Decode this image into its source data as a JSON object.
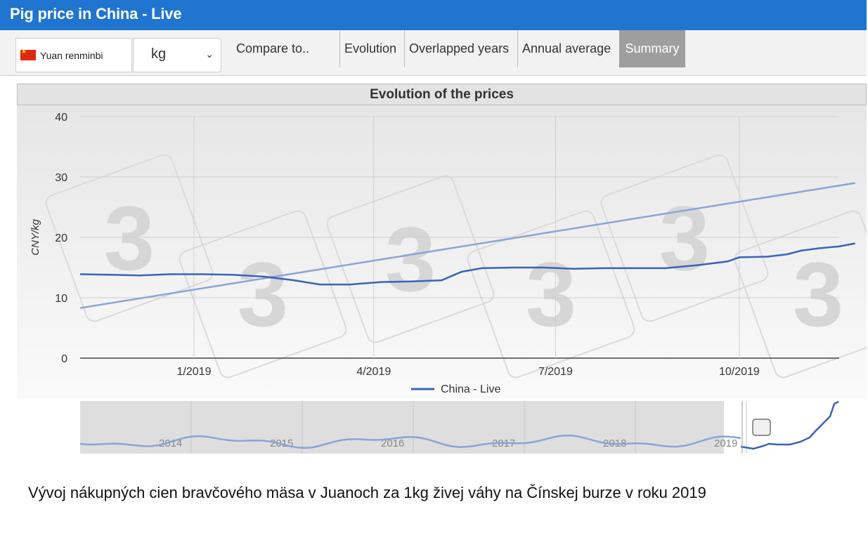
{
  "header": {
    "title": "Pig price in China - Live"
  },
  "toolbar": {
    "currency_label": "Yuan renminbi",
    "unit_value": "kg",
    "compare_label": "Compare to..",
    "tabs": [
      {
        "label": "Evolution"
      },
      {
        "label": "Overlapped years"
      },
      {
        "label": "Annual average"
      },
      {
        "label": "Summary",
        "active": true
      }
    ]
  },
  "colors": {
    "accent": "#1f75d0",
    "series": "#3a63b8",
    "trend": "#8aa4d8",
    "active_tab": "#9e9e9e"
  },
  "chart_data": {
    "type": "line",
    "title": "Evolution of the prices",
    "xlabel": "",
    "ylabel": "CNY/kg",
    "x_ticks": [
      "1/2019",
      "4/2019",
      "7/2019",
      "10/2019"
    ],
    "y_ticks": [
      0,
      10,
      20,
      30,
      40
    ],
    "ylim": [
      0,
      40
    ],
    "xlim": [
      "2018-11-05",
      "2019-11-20"
    ],
    "grid": true,
    "legend": "bottom",
    "series": [
      {
        "name": "China - Live",
        "points": [
          [
            "2018-11-05",
            13.9
          ],
          [
            "2018-11-20",
            13.8
          ],
          [
            "2018-12-05",
            13.7
          ],
          [
            "2018-12-20",
            13.9
          ],
          [
            "2019-01-05",
            13.9
          ],
          [
            "2019-01-20",
            13.8
          ],
          [
            "2019-02-05",
            13.5
          ],
          [
            "2019-02-20",
            12.9
          ],
          [
            "2019-03-05",
            12.2
          ],
          [
            "2019-03-20",
            12.2
          ],
          [
            "2019-04-05",
            12.6
          ],
          [
            "2019-04-20",
            12.7
          ],
          [
            "2019-05-05",
            12.9
          ],
          [
            "2019-05-15",
            14.3
          ],
          [
            "2019-05-25",
            14.9
          ],
          [
            "2019-06-10",
            15.0
          ],
          [
            "2019-06-25",
            15.0
          ],
          [
            "2019-07-10",
            14.8
          ],
          [
            "2019-07-25",
            14.9
          ],
          [
            "2019-08-10",
            14.9
          ],
          [
            "2019-08-25",
            14.9
          ],
          [
            "2019-09-10",
            15.4
          ],
          [
            "2019-09-25",
            16.0
          ],
          [
            "2019-10-01",
            16.7
          ],
          [
            "2019-10-15",
            16.8
          ],
          [
            "2019-10-25",
            17.2
          ],
          [
            "2019-11-01",
            17.8
          ],
          [
            "2019-11-10",
            18.2
          ],
          [
            "2019-11-20",
            18.5
          ],
          [
            "2019-11-28",
            19.0
          ]
        ]
      }
    ],
    "trendline": [
      [
        "2018-11-05",
        8.3
      ],
      [
        "2019-11-28",
        29.0
      ]
    ]
  },
  "navigator": {
    "year_labels": [
      "2014",
      "2015",
      "2016",
      "2017",
      "2018",
      "2019"
    ]
  },
  "caption": "Vývoj nákupných cien bravčového mäsa v Juanoch za 1kg živej váhy na Čínskej burze v roku 2019"
}
